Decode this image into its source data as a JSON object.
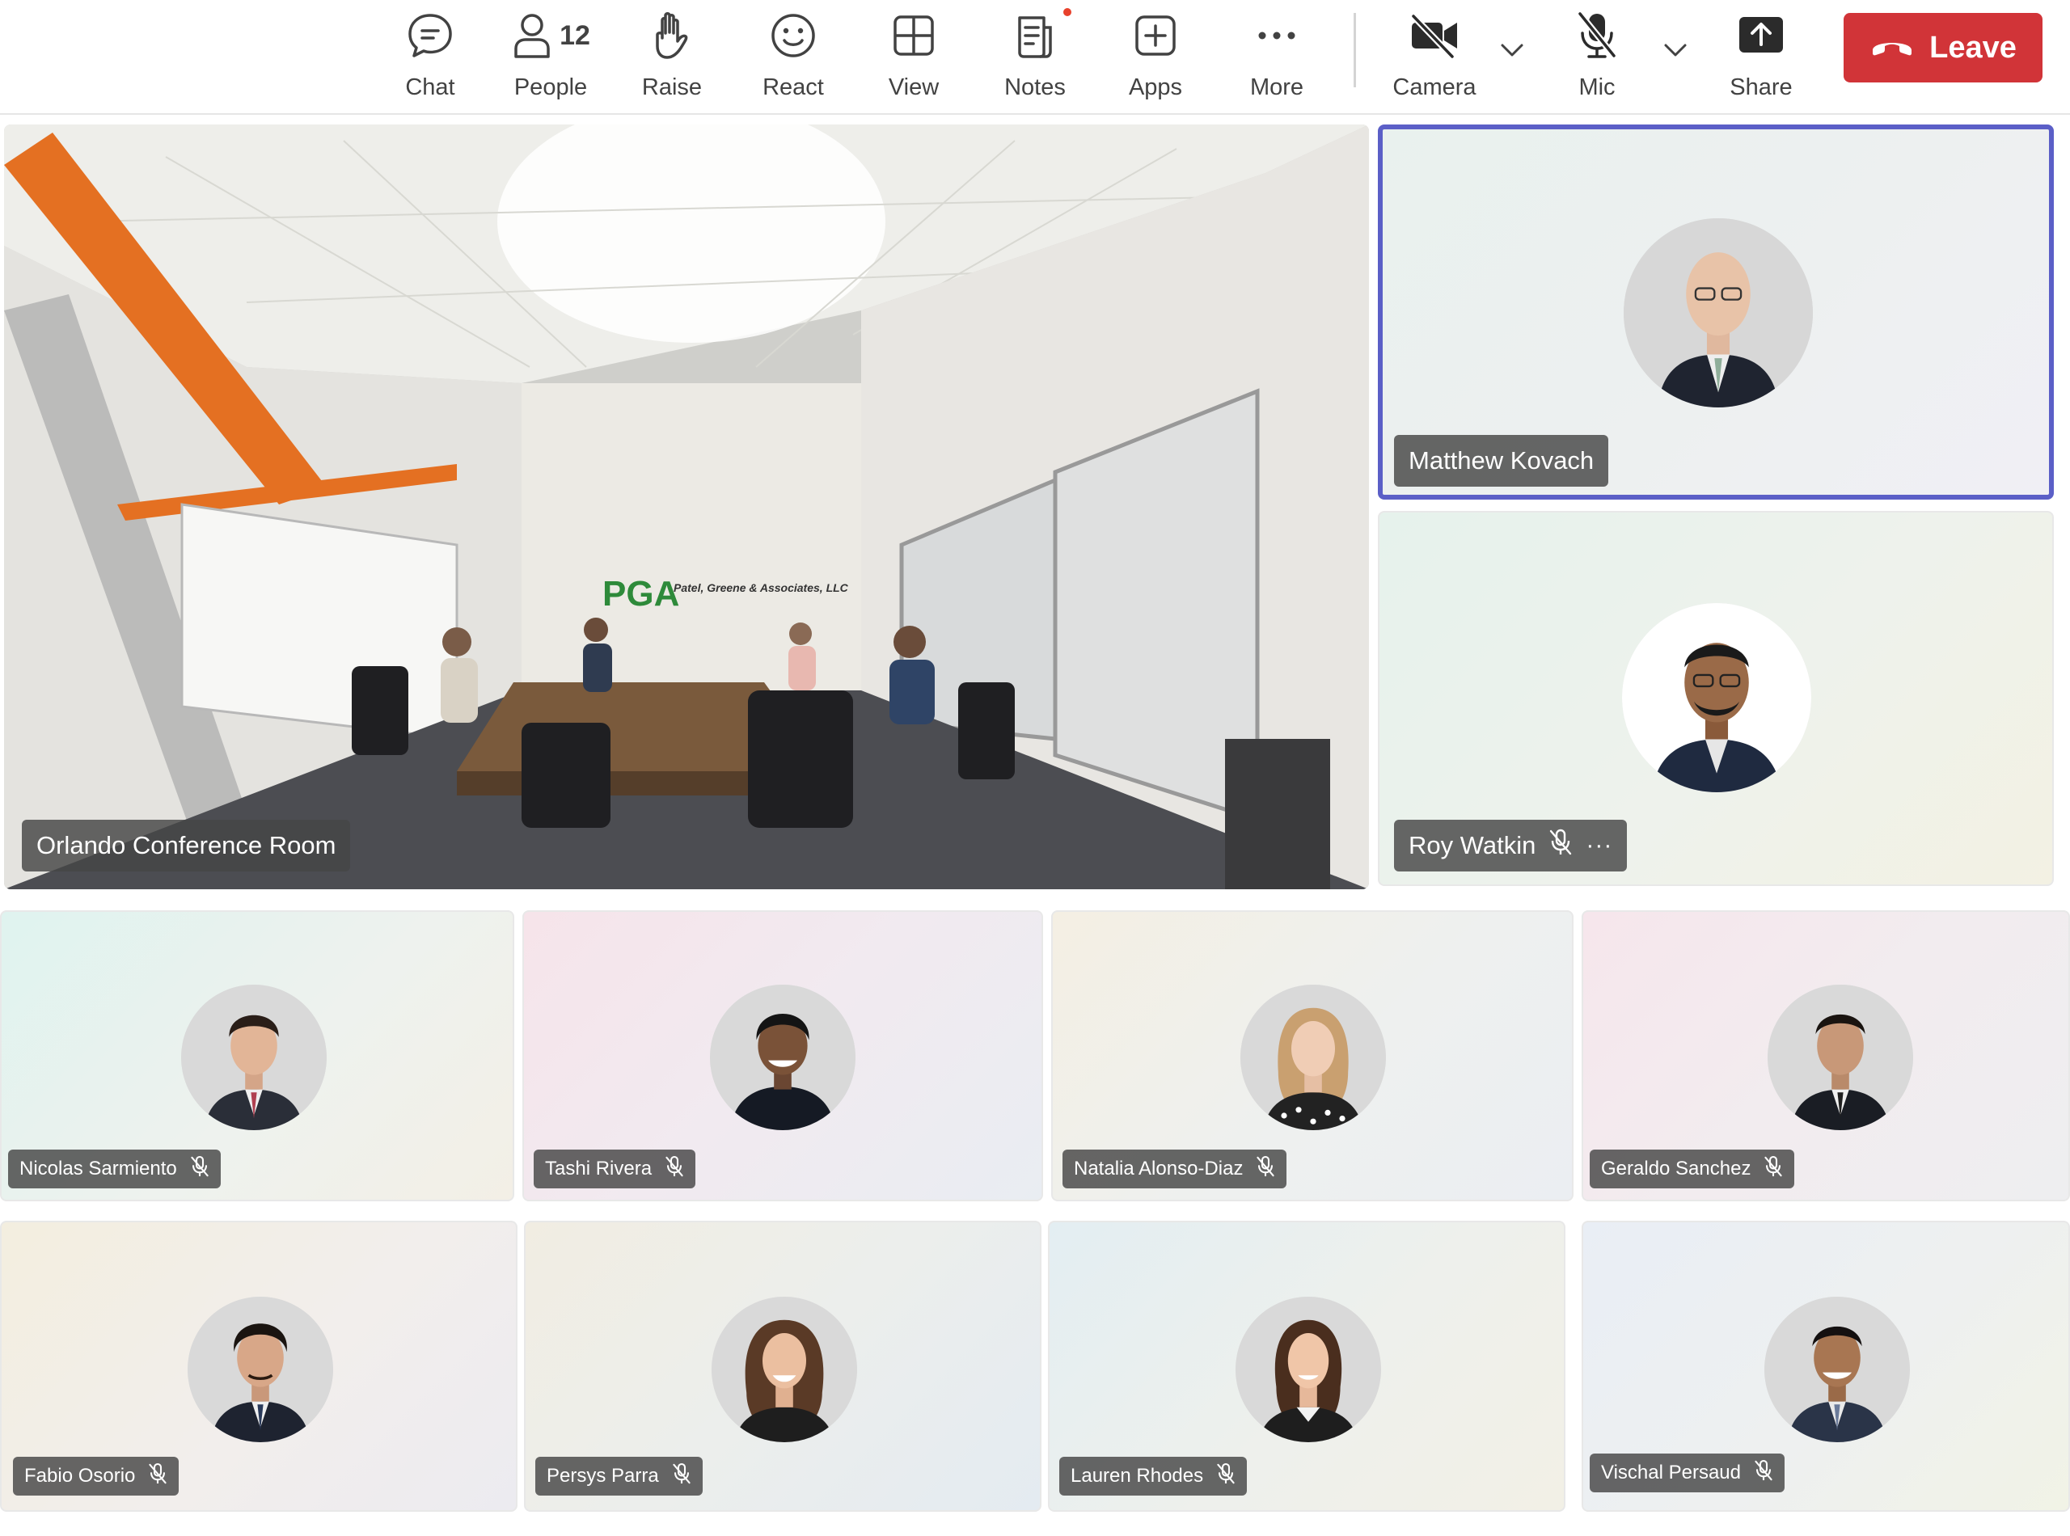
{
  "toolbar": {
    "chat": {
      "label": "Chat",
      "icon": "chat-icon"
    },
    "people": {
      "label": "People",
      "count": "12",
      "icon": "people-icon"
    },
    "raise": {
      "label": "Raise",
      "icon": "raise-hand-icon"
    },
    "react": {
      "label": "React",
      "icon": "smiley-icon"
    },
    "view": {
      "label": "View",
      "icon": "grid-icon"
    },
    "notes": {
      "label": "Notes",
      "icon": "notes-icon",
      "has_notification": true
    },
    "apps": {
      "label": "Apps",
      "icon": "add-square-icon"
    },
    "more": {
      "label": "More",
      "icon": "ellipsis-icon"
    },
    "camera": {
      "label": "Camera",
      "icon": "camera-off-icon",
      "state": "off"
    },
    "mic": {
      "label": "Mic",
      "icon": "mic-off-icon",
      "state": "muted"
    },
    "share": {
      "label": "Share",
      "icon": "share-icon"
    },
    "leave": {
      "label": "Leave",
      "icon": "phone-hangup-icon"
    }
  },
  "colors": {
    "leave_button": "#d13438",
    "active_speaker_border": "#5b5fc7",
    "notification_dot": "#e8412c"
  },
  "room": {
    "name": "Orlando Conference Room",
    "wall_logo_text": "Patel, Greene & Associates, LLC",
    "wall_logo_mark": "PGA"
  },
  "featured": [
    {
      "name": "Matthew Kovach",
      "muted": false,
      "active_speaker": true
    },
    {
      "name": "Roy Watkin",
      "muted": true,
      "active_speaker": false,
      "has_more_menu": true
    }
  ],
  "grid": [
    {
      "name": "Nicolas Sarmiento",
      "muted": true
    },
    {
      "name": "Tashi Rivera",
      "muted": true
    },
    {
      "name": "Natalia Alonso-Diaz",
      "muted": true
    },
    {
      "name": "Geraldo Sanchez",
      "muted": true
    },
    {
      "name": "Fabio Osorio",
      "muted": true
    },
    {
      "name": "Persys Parra",
      "muted": true
    },
    {
      "name": "Lauren Rhodes",
      "muted": true
    },
    {
      "name": "Vischal Persaud",
      "muted": true
    }
  ]
}
